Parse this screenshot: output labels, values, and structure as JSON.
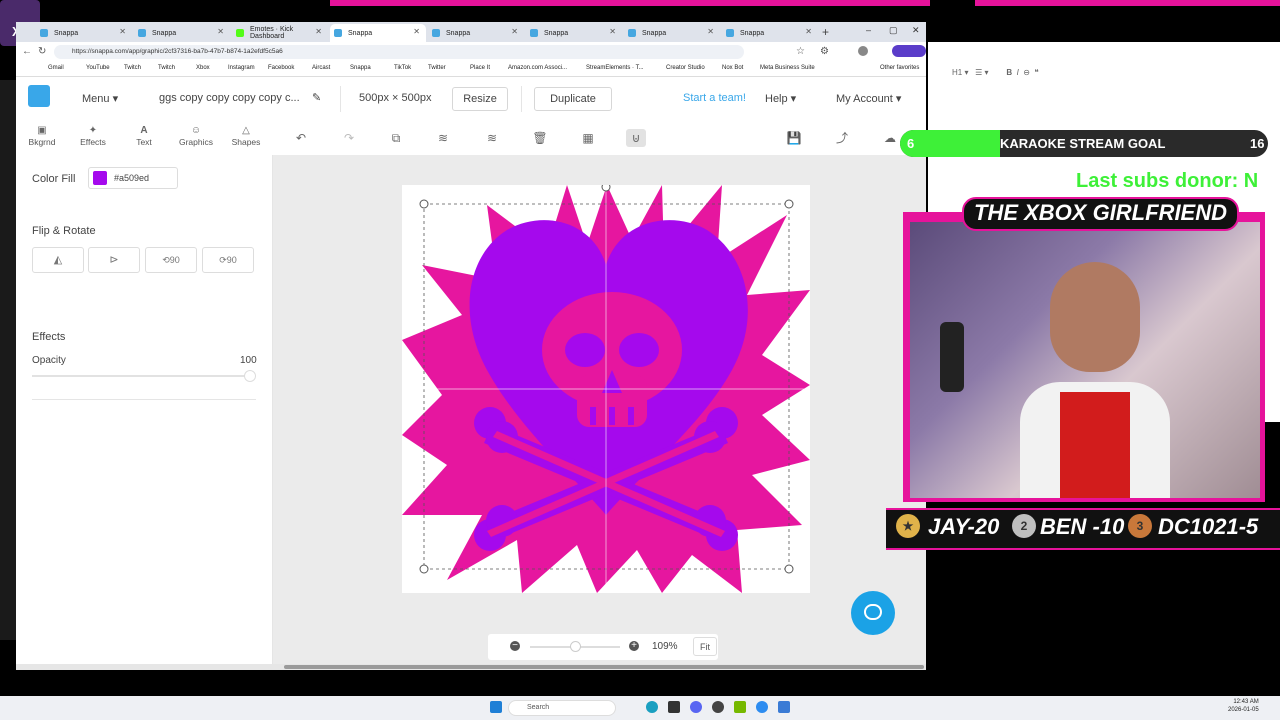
{
  "browser": {
    "tabs": [
      {
        "label": "Snappa",
        "kick": false,
        "active": false
      },
      {
        "label": "Snappa",
        "kick": false,
        "active": false
      },
      {
        "label": "Emotes · Kick Dashboard",
        "kick": true,
        "active": false
      },
      {
        "label": "Snappa",
        "kick": false,
        "active": true
      },
      {
        "label": "Snappa",
        "kick": false,
        "active": false
      },
      {
        "label": "Snappa",
        "kick": false,
        "active": false
      },
      {
        "label": "Snappa",
        "kick": false,
        "active": false
      },
      {
        "label": "Snappa",
        "kick": false,
        "active": false
      }
    ],
    "url": "https://snappa.com/app/graphic/2cf37316-ba7b-47b7-b874-1a2efdf5c5a6",
    "bookmarks": [
      "Gmail",
      "YouTube",
      "Twitch",
      "Twitch",
      "Xbox",
      "Instagram",
      "Facebook",
      "Aircast",
      "Snappa",
      "TikTok",
      "Twitter",
      "Place It",
      "Amazon.com Associ...",
      "StreamElements · T...",
      "Creator Studio",
      "Nox Bot",
      "Meta Business Suite"
    ],
    "other_favorites": "Other favorites"
  },
  "snappa": {
    "menu": "Menu",
    "doc_title": "ggs copy copy copy copy c...",
    "size": "500px × 500px",
    "resize": "Resize",
    "duplicate": "Duplicate",
    "start_team": "Start a team!",
    "help": "Help",
    "account": "My Account",
    "side_tabs": [
      "Bkgrnd",
      "Effects",
      "Text",
      "Graphics",
      "Shapes"
    ],
    "panel": {
      "color_fill_label": "Color Fill",
      "color_fill_value": "#a509ed",
      "flip_rotate_label": "Flip & Rotate",
      "rotate_left": "90",
      "rotate_right": "90",
      "effects_label": "Effects",
      "opacity_label": "Opacity",
      "opacity_value": "100"
    },
    "zoom": "109%",
    "fit": "Fit",
    "colors": {
      "pink": "#e6169f",
      "purple": "#a509ed",
      "accent": "#39a7e9"
    }
  },
  "overlay": {
    "goal_left": "6",
    "goal_title": "KARAOKE STREAM GOAL",
    "goal_right": "16",
    "donor": "Last subs donor: N",
    "cam_title": "THE XBOX GIRLFRIEND",
    "leaders": [
      {
        "rank": "",
        "text": "JAY-20"
      },
      {
        "rank": "2",
        "text": "BEN -10"
      },
      {
        "rank": "3",
        "text": "DC1021-5"
      }
    ]
  },
  "taskbar": {
    "search": "Search",
    "time": "12:43 AM",
    "date": "2026-01-05"
  }
}
